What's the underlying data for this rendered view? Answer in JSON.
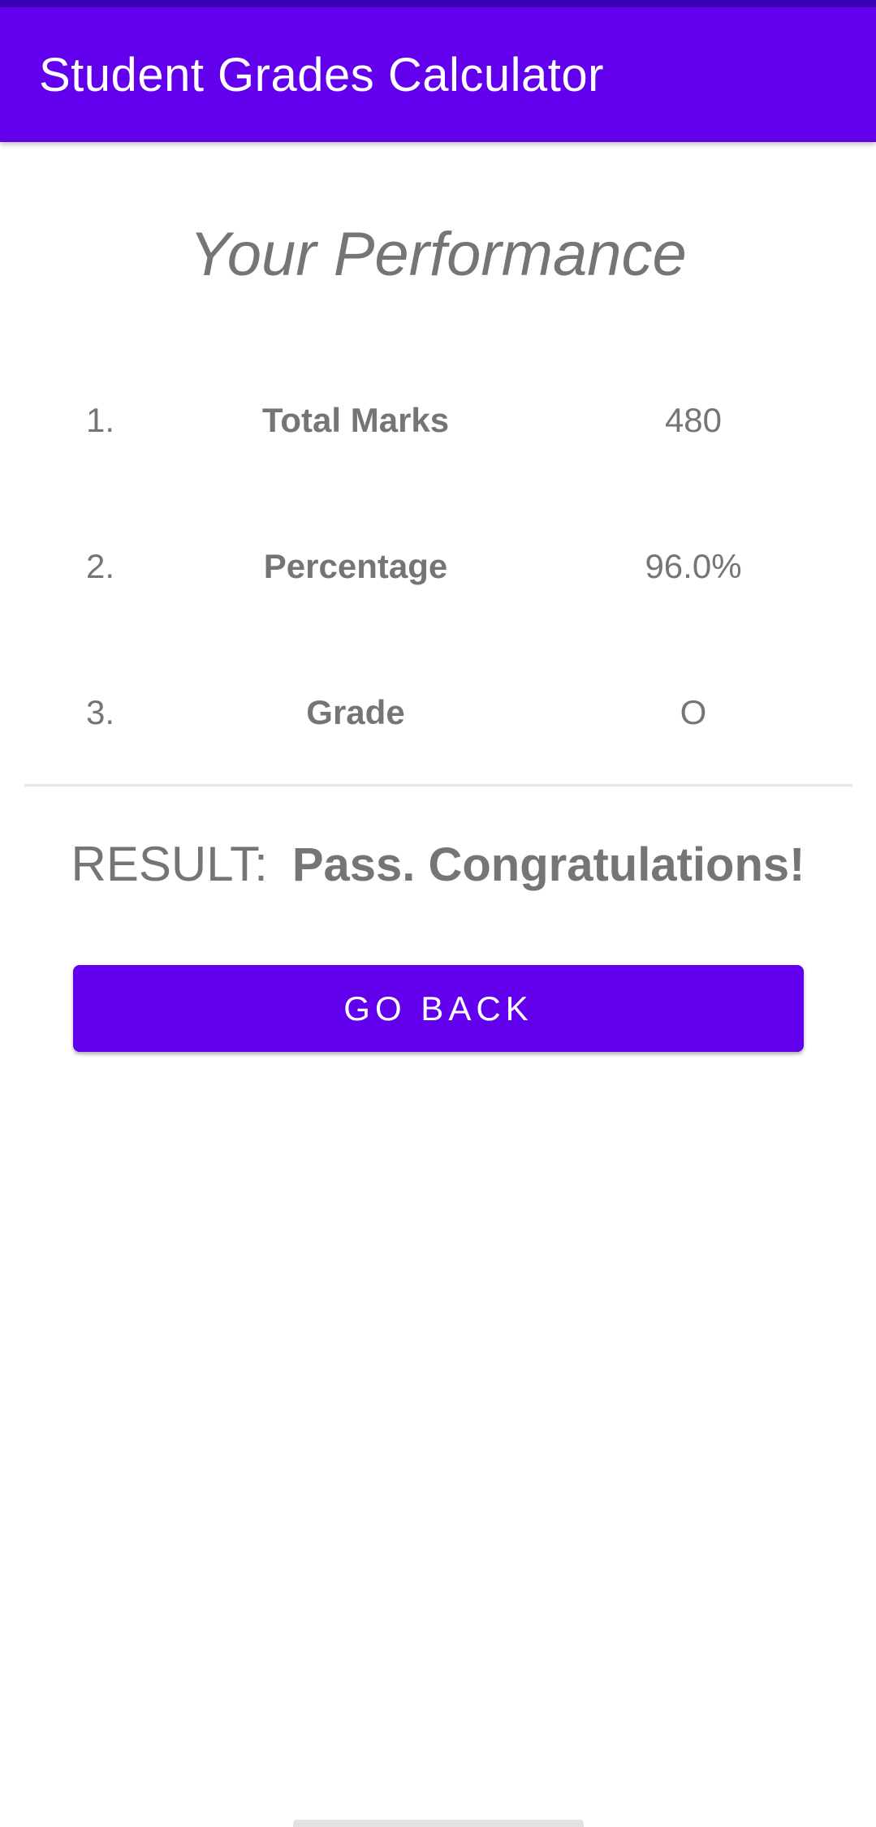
{
  "app_bar": {
    "title": "Student Grades Calculator",
    "color": "#6200ee",
    "status_color": "#3a00b3"
  },
  "main": {
    "heading": "Your Performance",
    "rows": [
      {
        "number": "1.",
        "label": "Total Marks",
        "value": "480"
      },
      {
        "number": "2.",
        "label": "Percentage",
        "value": "96.0%"
      },
      {
        "number": "3.",
        "label": "Grade",
        "value": "O"
      }
    ],
    "result": {
      "label": "RESULT:",
      "text": "Pass. Congratulations!"
    },
    "go_back_label": "GO BACK",
    "text_color": "#757575"
  }
}
